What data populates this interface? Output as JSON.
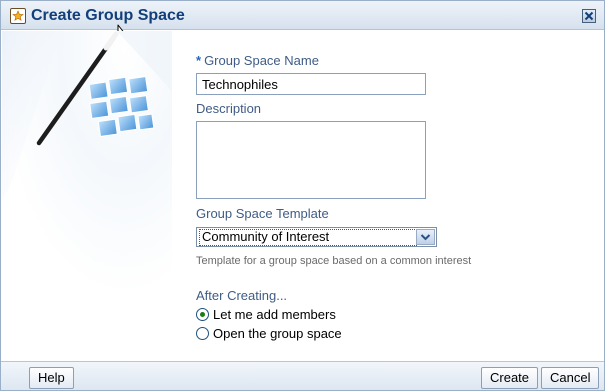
{
  "dialog": {
    "title": "Create Group Space",
    "title_icon": "group-space-icon",
    "close_icon": "close-icon"
  },
  "form": {
    "name_required_marker": "*",
    "name_label": "Group Space Name",
    "name_value": "Technophiles",
    "description_label": "Description",
    "description_value": "",
    "template_label": "Group Space Template",
    "template_selected": "Community of Interest",
    "template_hint": "Template for a group space based on a common interest",
    "after_label": "After Creating...",
    "after_options": [
      {
        "label": "Let me add members",
        "checked": true
      },
      {
        "label": "Open the group space",
        "checked": false
      }
    ]
  },
  "footer": {
    "help_label": "Help",
    "create_label": "Create",
    "cancel_label": "Cancel"
  },
  "colors": {
    "title_text": "#123f7a",
    "label_text": "#3f5c86",
    "required_marker": "#2868b8",
    "hint_text": "#6a6a6a",
    "radio_selected": "#1b7b1b"
  }
}
